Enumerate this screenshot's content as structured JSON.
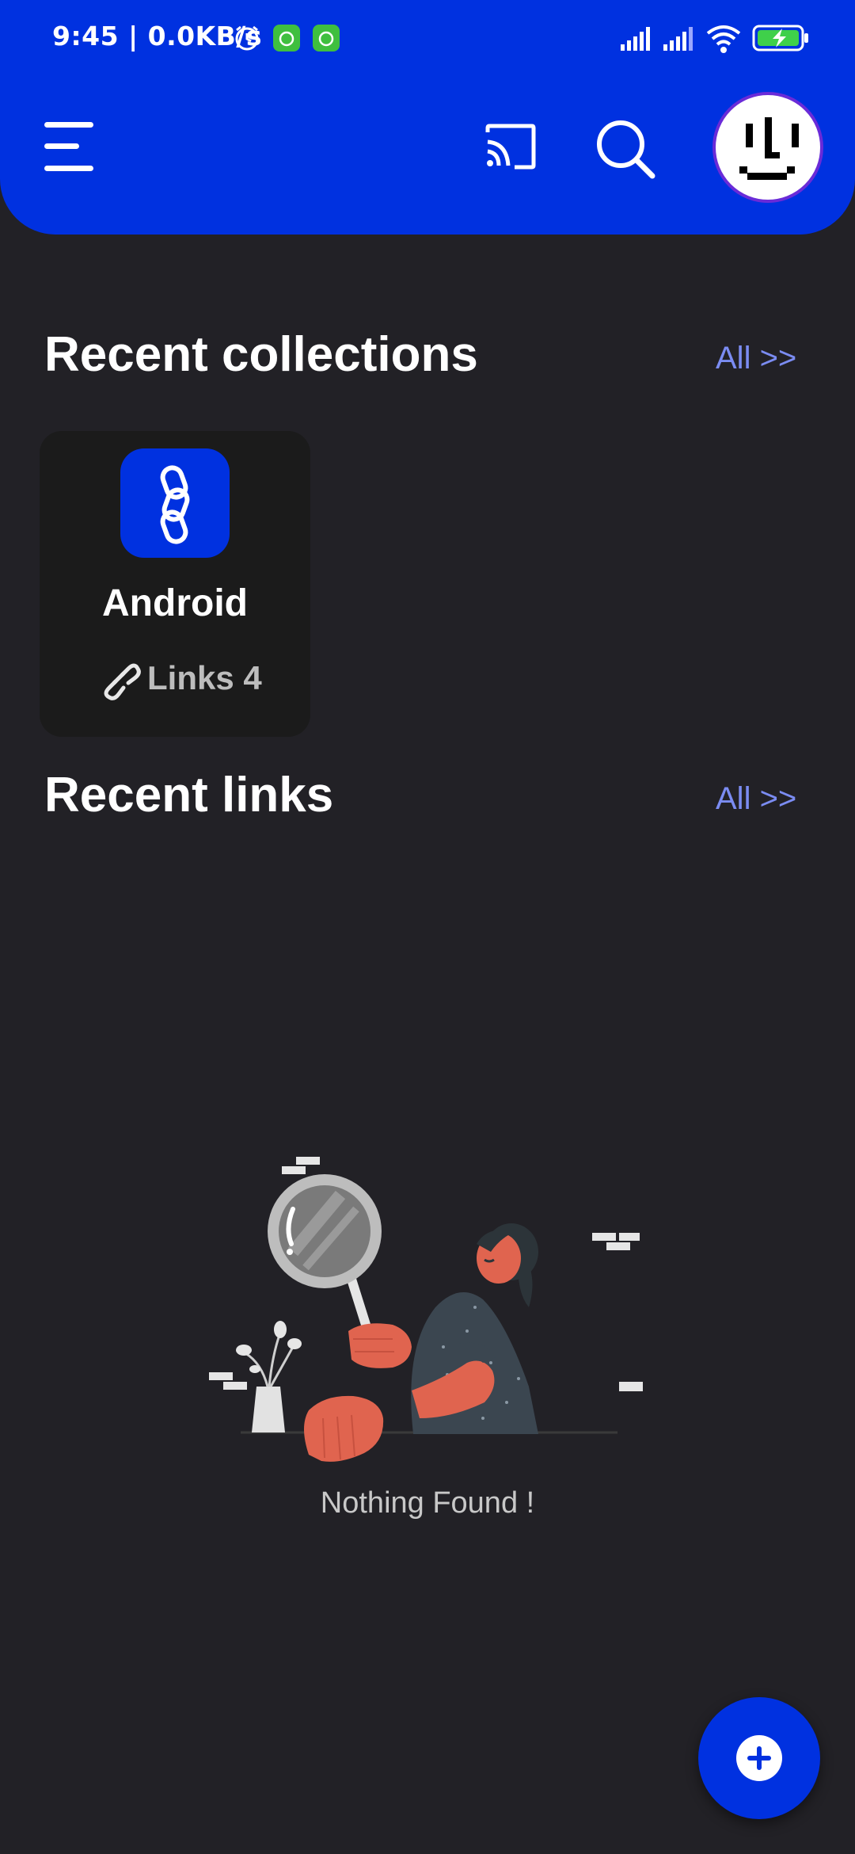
{
  "status_bar": {
    "time": "9:45 | 0.0KB/s"
  },
  "app_bar": {
    "icons": [
      "menu-icon",
      "cast-icon",
      "search-icon",
      "avatar-icon"
    ]
  },
  "collections_section": {
    "title": "Recent collections",
    "all_label": "All >>",
    "items": [
      {
        "name": "Android",
        "links_label": "Links 4",
        "icon": "chain-icon"
      }
    ]
  },
  "links_section": {
    "title": "Recent links",
    "all_label": "All >>",
    "empty_text": "Nothing Found !"
  },
  "fab": {
    "icon": "plus-icon"
  },
  "colors": {
    "primary": "#0031e0",
    "background": "#222126",
    "card": "#1b1b1b",
    "link_accent": "#7b8cf2",
    "illustration_skin": "#e0644f"
  }
}
